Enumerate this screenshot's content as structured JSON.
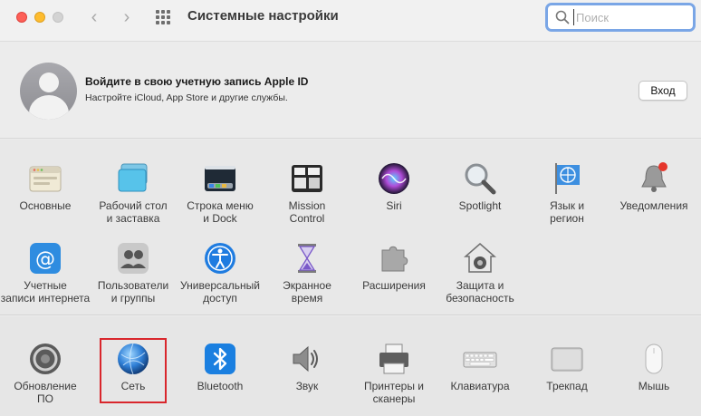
{
  "window": {
    "title": "Системные настройки",
    "back_glyph": "‹",
    "forward_glyph": "›"
  },
  "search": {
    "placeholder": "Поиск",
    "value": ""
  },
  "account": {
    "title": "Войдите в свою учетную запись Apple ID",
    "subtitle": "Настройте iCloud, App Store и другие службы.",
    "login_label": "Вход"
  },
  "panes_row1": [
    {
      "label": "Основные",
      "icon": "general-icon"
    },
    {
      "label": "Рабочий стол\nи заставка",
      "icon": "desktop-icon"
    },
    {
      "label": "Строка меню\nи Dock",
      "icon": "dock-icon"
    },
    {
      "label": "Mission\nControl",
      "icon": "mission-control-icon"
    },
    {
      "label": "Siri",
      "icon": "siri-icon"
    },
    {
      "label": "Spotlight",
      "icon": "spotlight-icon"
    },
    {
      "label": "Язык и\nрегион",
      "icon": "language-icon"
    },
    {
      "label": "Уведомления",
      "icon": "notifications-icon"
    }
  ],
  "panes_row2": [
    {
      "label": "Учетные\nзаписи интернета",
      "icon": "internet-accounts-icon"
    },
    {
      "label": "Пользователи\nи группы",
      "icon": "users-icon"
    },
    {
      "label": "Универсальный\nдоступ",
      "icon": "accessibility-icon"
    },
    {
      "label": "Экранное\nвремя",
      "icon": "screen-time-icon"
    },
    {
      "label": "Расширения",
      "icon": "extensions-icon"
    },
    {
      "label": "Защита и\nбезопасность",
      "icon": "security-icon"
    }
  ],
  "panes_row3": [
    {
      "label": "Обновление\nПО",
      "icon": "software-update-icon"
    },
    {
      "label": "Сеть",
      "icon": "network-icon"
    },
    {
      "label": "Bluetooth",
      "icon": "bluetooth-icon"
    },
    {
      "label": "Звук",
      "icon": "sound-icon"
    },
    {
      "label": "Принтеры и\nсканеры",
      "icon": "printers-icon"
    },
    {
      "label": "Клавиатура",
      "icon": "keyboard-icon"
    },
    {
      "label": "Трекпад",
      "icon": "trackpad-icon"
    },
    {
      "label": "Мышь",
      "icon": "mouse-icon"
    }
  ],
  "colors": {
    "highlight": "#d9262c",
    "search_focus": "#7aa6e6"
  }
}
